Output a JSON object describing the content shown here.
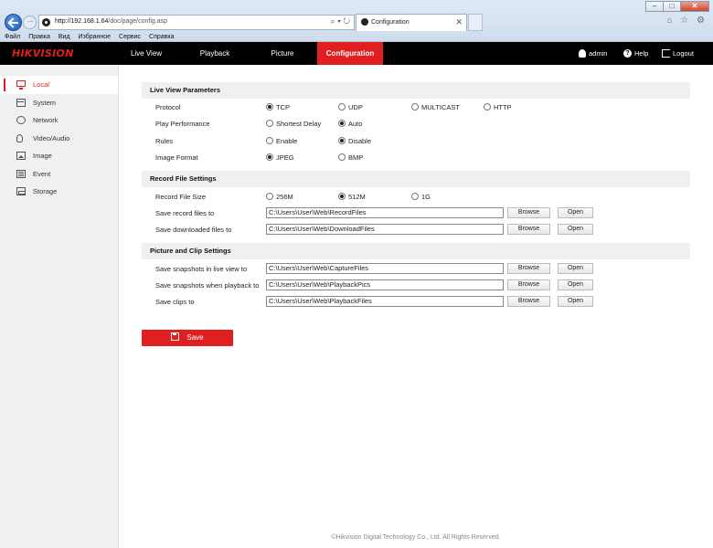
{
  "browser": {
    "url_host": "http://192.168.1.64",
    "url_path": "/doc/page/config.asp",
    "address_icons": "⌕ ▾ ↻",
    "tab_title": "Configuration",
    "tab_close": "✕",
    "toolbar_icons": "⌂ ☆ ⚙",
    "window_buttons": [
      "–",
      "□",
      "✕"
    ],
    "menu": [
      "Файл",
      "Правка",
      "Вид",
      "Избранное",
      "Сервис",
      "Справка"
    ]
  },
  "header": {
    "logo": "HIKVISION",
    "nav": [
      "Live View",
      "Playback",
      "Picture",
      "Configuration"
    ],
    "active_nav": "Configuration",
    "user": "admin",
    "help": "Help",
    "logout": "Logout",
    "accent_color": "#e02020"
  },
  "sidebar": {
    "items": [
      {
        "label": "Local",
        "icon": "monitor-icon",
        "active": true
      },
      {
        "label": "System",
        "icon": "system-icon"
      },
      {
        "label": "Network",
        "icon": "network-icon"
      },
      {
        "label": "Video/Audio",
        "icon": "video-audio-icon"
      },
      {
        "label": "Image",
        "icon": "image-icon"
      },
      {
        "label": "Event",
        "icon": "event-icon"
      },
      {
        "label": "Storage",
        "icon": "storage-icon"
      }
    ]
  },
  "live_view": {
    "title": "Live View Parameters",
    "protocol": {
      "label": "Protocol",
      "options": [
        "TCP",
        "UDP",
        "MULTICAST",
        "HTTP"
      ],
      "selected": "TCP"
    },
    "play_performance": {
      "label": "Play Performance",
      "options": [
        "Shortest Delay",
        "Auto"
      ],
      "selected": "Auto"
    },
    "rules": {
      "label": "Rules",
      "options": [
        "Enable",
        "Disable"
      ],
      "selected": "Disable"
    },
    "image_format": {
      "label": "Image Format",
      "options": [
        "JPEG",
        "BMP"
      ],
      "selected": "JPEG"
    }
  },
  "record_file": {
    "title": "Record File Settings",
    "size": {
      "label": "Record File Size",
      "options": [
        "256M",
        "512M",
        "1G"
      ],
      "selected": "512M"
    },
    "save_record": {
      "label": "Save record files to",
      "value": "C:\\Users\\User\\Web\\RecordFiles"
    },
    "save_download": {
      "label": "Save downloaded files to",
      "value": "C:\\Users\\User\\Web\\DownloadFiles"
    }
  },
  "picture_clip": {
    "title": "Picture and Clip Settings",
    "snap_live": {
      "label": "Save snapshots in live view to",
      "value": "C:\\Users\\User\\Web\\CaptureFiles"
    },
    "snap_playback": {
      "label": "Save snapshots when playback to",
      "value": "C:\\Users\\User\\Web\\PlaybackPics"
    },
    "clips": {
      "label": "Save clips to",
      "value": "C:\\Users\\User\\Web\\PlaybackFiles"
    }
  },
  "buttons": {
    "browse": "Browse",
    "open": "Open",
    "save": "Save"
  },
  "footer": "©Hikvision Digital Technology Co., Ltd. All Rights Reserved."
}
